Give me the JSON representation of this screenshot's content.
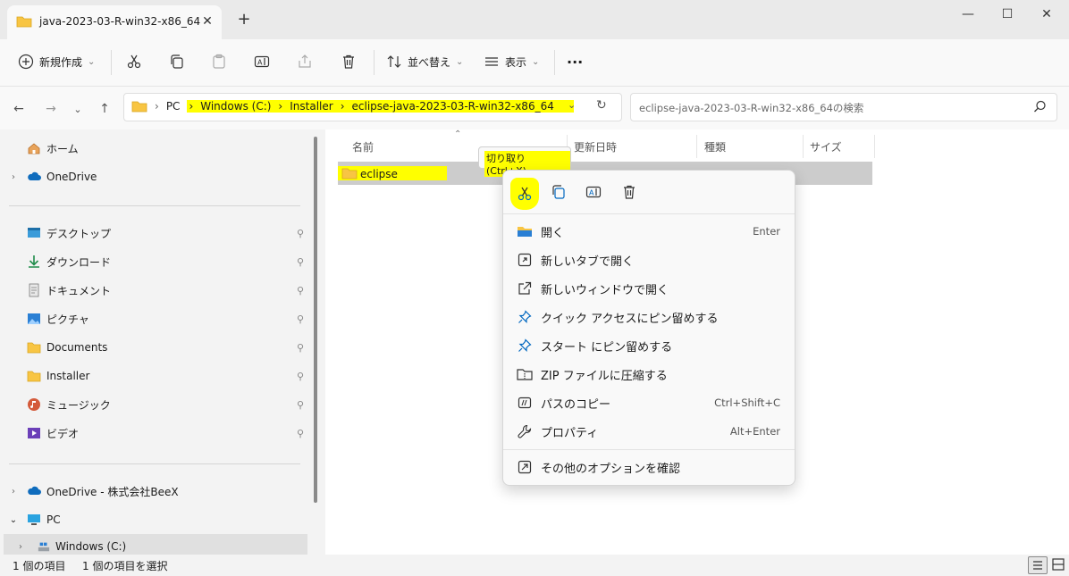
{
  "window": {
    "tab_title": "java-2023-03-R-win32-x86_64",
    "new_tab_symbol": "+",
    "close_tab_symbol": "✕",
    "minimize_symbol": "—",
    "maximize_symbol": "☐",
    "close_symbol": "✕"
  },
  "toolbar": {
    "new_label": "新規作成",
    "new_chevron": "⌄",
    "sort_label": "並べ替え",
    "sort_chevron": "⌄",
    "view_label": "表示",
    "view_chevron": "⌄",
    "more_label": "···",
    "icons": [
      "cut-icon",
      "copy-icon",
      "paste-icon",
      "rename-icon",
      "share-icon",
      "delete-icon"
    ]
  },
  "nav": {
    "back": "←",
    "forward": "→",
    "recent": "⌄",
    "up": "↑",
    "breadcrumbs": [
      "PC",
      "Windows (C:)",
      "Installer",
      "eclipse-java-2023-03-R-win32-x86_64"
    ],
    "separator": "›",
    "dropdown": "⌄",
    "refresh": "↻",
    "search_placeholder": "eclipse-java-2023-03-R-win32-x86_64の検索"
  },
  "sidebar": {
    "top": [
      {
        "label": "ホーム",
        "icon": "home-icon",
        "chevron": ""
      },
      {
        "label": "OneDrive",
        "icon": "cloud-icon",
        "chevron": "›"
      }
    ],
    "quick": [
      {
        "label": "デスクトップ",
        "icon": "desktop-icon"
      },
      {
        "label": "ダウンロード",
        "icon": "download-icon"
      },
      {
        "label": "ドキュメント",
        "icon": "document-icon"
      },
      {
        "label": "ピクチャ",
        "icon": "pictures-icon"
      },
      {
        "label": "Documents",
        "icon": "folder-icon"
      },
      {
        "label": "Installer",
        "icon": "folder-icon"
      },
      {
        "label": "ミュージック",
        "icon": "music-icon"
      },
      {
        "label": "ビデオ",
        "icon": "video-icon"
      }
    ],
    "pin_symbol": "📌",
    "bottom": [
      {
        "label": "OneDrive - 株式会社BeeX",
        "icon": "cloud-icon",
        "chevron": "›"
      },
      {
        "label": "PC",
        "icon": "pc-icon",
        "chevron": "⌄"
      },
      {
        "label": "Windows (C:)",
        "icon": "drive-icon",
        "chevron": "›"
      }
    ]
  },
  "columns": {
    "name": "名前",
    "modified": "更新日時",
    "type": "種類",
    "size": "サイズ",
    "sort_arrow": "⌃"
  },
  "files": [
    {
      "name": "eclipse"
    }
  ],
  "tooltip": "切り取り (Ctrl+X)",
  "context_menu": {
    "top_icons": [
      "cut-icon",
      "copy-icon",
      "rename-icon",
      "delete-icon"
    ],
    "items": [
      {
        "label": "開く",
        "shortcut": "Enter",
        "icon": "open-folder-icon"
      },
      {
        "label": "新しいタブで開く",
        "shortcut": "",
        "icon": "new-tab-icon"
      },
      {
        "label": "新しいウィンドウで開く",
        "shortcut": "",
        "icon": "new-window-icon"
      },
      {
        "label": "クイック アクセスにピン留めする",
        "shortcut": "",
        "icon": "pin-icon"
      },
      {
        "label": "スタート にピン留めする",
        "shortcut": "",
        "icon": "pin-icon"
      },
      {
        "label": "ZIP ファイルに圧縮する",
        "shortcut": "",
        "icon": "zip-icon"
      },
      {
        "label": "パスのコピー",
        "shortcut": "Ctrl+Shift+C",
        "icon": "path-icon"
      },
      {
        "label": "プロパティ",
        "shortcut": "Alt+Enter",
        "icon": "wrench-icon"
      }
    ],
    "more": {
      "label": "その他のオプションを確認",
      "icon": "more-options-icon"
    }
  },
  "status": {
    "item_count": "1 個の項目",
    "selected_count": "1 個の項目を選択"
  },
  "colors": {
    "highlight": "#ffff00",
    "accent": "#0067c0",
    "folder": "#f8c543"
  }
}
